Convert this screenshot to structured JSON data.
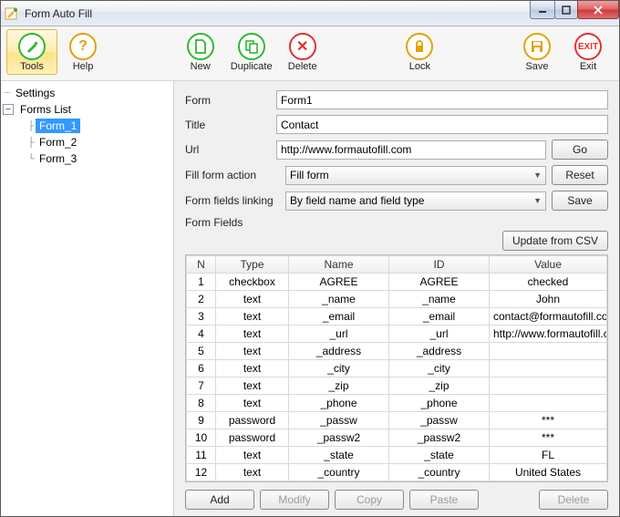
{
  "app": {
    "title": "Form Auto Fill"
  },
  "toolbar": {
    "tools": "Tools",
    "help": "Help",
    "new": "New",
    "duplicate": "Duplicate",
    "delete": "Delete",
    "lock": "Lock",
    "save": "Save",
    "exit": "Exit"
  },
  "tree": {
    "settings": "Settings",
    "forms_list": "Forms List",
    "form1": "Form_1",
    "form2": "Form_2",
    "form3": "Form_3"
  },
  "panel": {
    "form_label": "Form",
    "form_value": "Form1",
    "title_label": "Title",
    "title_value": "Contact",
    "url_label": "Url",
    "url_value": "http://www.formautofill.com",
    "go": "Go",
    "fill_action_label": "Fill form action",
    "fill_action_value": "Fill form",
    "reset": "Reset",
    "linking_label": "Form fields linking",
    "linking_value": "By field name and field type",
    "save": "Save",
    "form_fields": "Form Fields",
    "update_csv": "Update from CSV",
    "headers": {
      "n": "N",
      "type": "Type",
      "name": "Name",
      "id": "ID",
      "value": "Value"
    },
    "rows": [
      {
        "n": "1",
        "type": "checkbox",
        "name": "AGREE",
        "id": "AGREE",
        "value": "checked"
      },
      {
        "n": "2",
        "type": "text",
        "name": "_name",
        "id": "_name",
        "value": "John"
      },
      {
        "n": "3",
        "type": "text",
        "name": "_email",
        "id": "_email",
        "value": "contact@formautofill.co"
      },
      {
        "n": "4",
        "type": "text",
        "name": "_url",
        "id": "_url",
        "value": "http://www.formautofill.c"
      },
      {
        "n": "5",
        "type": "text",
        "name": "_address",
        "id": "_address",
        "value": ""
      },
      {
        "n": "6",
        "type": "text",
        "name": "_city",
        "id": "_city",
        "value": ""
      },
      {
        "n": "7",
        "type": "text",
        "name": "_zip",
        "id": "_zip",
        "value": ""
      },
      {
        "n": "8",
        "type": "text",
        "name": "_phone",
        "id": "_phone",
        "value": ""
      },
      {
        "n": "9",
        "type": "password",
        "name": "_passw",
        "id": "_passw",
        "value": "***"
      },
      {
        "n": "10",
        "type": "password",
        "name": "_passw2",
        "id": "_passw2",
        "value": "***"
      },
      {
        "n": "11",
        "type": "text",
        "name": "_state",
        "id": "_state",
        "value": "FL"
      },
      {
        "n": "12",
        "type": "text",
        "name": "_country",
        "id": "_country",
        "value": "United States"
      }
    ],
    "add": "Add",
    "modify": "Modify",
    "copy": "Copy",
    "paste": "Paste",
    "delete": "Delete"
  }
}
